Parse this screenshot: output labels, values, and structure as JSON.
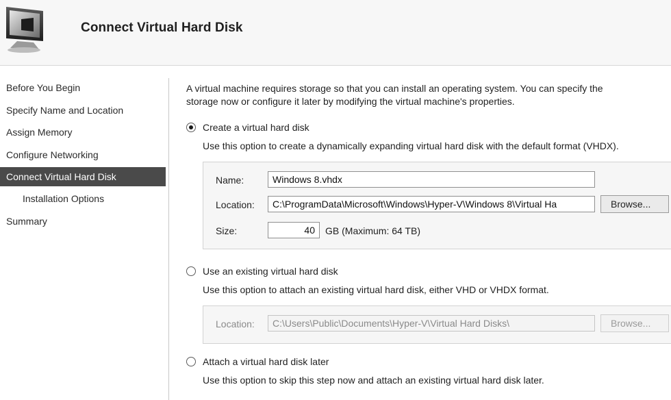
{
  "header": {
    "title": "Connect Virtual Hard Disk",
    "icon": "monitor-wizard-icon"
  },
  "nav": {
    "items": [
      {
        "label": "Before You Begin",
        "selected": false
      },
      {
        "label": "Specify Name and Location",
        "selected": false
      },
      {
        "label": "Assign Memory",
        "selected": false
      },
      {
        "label": "Configure Networking",
        "selected": false
      },
      {
        "label": "Connect Virtual Hard Disk",
        "selected": true
      },
      {
        "label": "Installation Options",
        "selected": false,
        "indent": true
      },
      {
        "label": "Summary",
        "selected": false
      }
    ]
  },
  "content": {
    "intro_line1": "A virtual machine requires storage so that you can install an operating system. You can specify the",
    "intro_line2": "storage now or configure it later by modifying the virtual machine's properties.",
    "create": {
      "label": "Create a virtual hard disk",
      "checked": true,
      "description": "Use this option to create a dynamically expanding virtual hard disk with the default format (VHDX).",
      "name_label": "Name:",
      "name_value": "Windows 8.vhdx",
      "location_label": "Location:",
      "location_value": "C:\\ProgramData\\Microsoft\\Windows\\Hyper-V\\Windows 8\\Virtual Ha",
      "browse_label": "Browse...",
      "size_label": "Size:",
      "size_value": "40",
      "size_unit": "GB (Maximum: 64 TB)"
    },
    "existing": {
      "label": "Use an existing virtual hard disk",
      "checked": false,
      "description": "Use this option to attach an existing virtual hard disk, either VHD or VHDX format.",
      "location_label": "Location:",
      "location_value": "C:\\Users\\Public\\Documents\\Hyper-V\\Virtual Hard Disks\\",
      "browse_label": "Browse..."
    },
    "later": {
      "label": "Attach a virtual hard disk later",
      "checked": false,
      "description": "Use this option to skip this step now and attach an existing virtual hard disk later."
    }
  }
}
